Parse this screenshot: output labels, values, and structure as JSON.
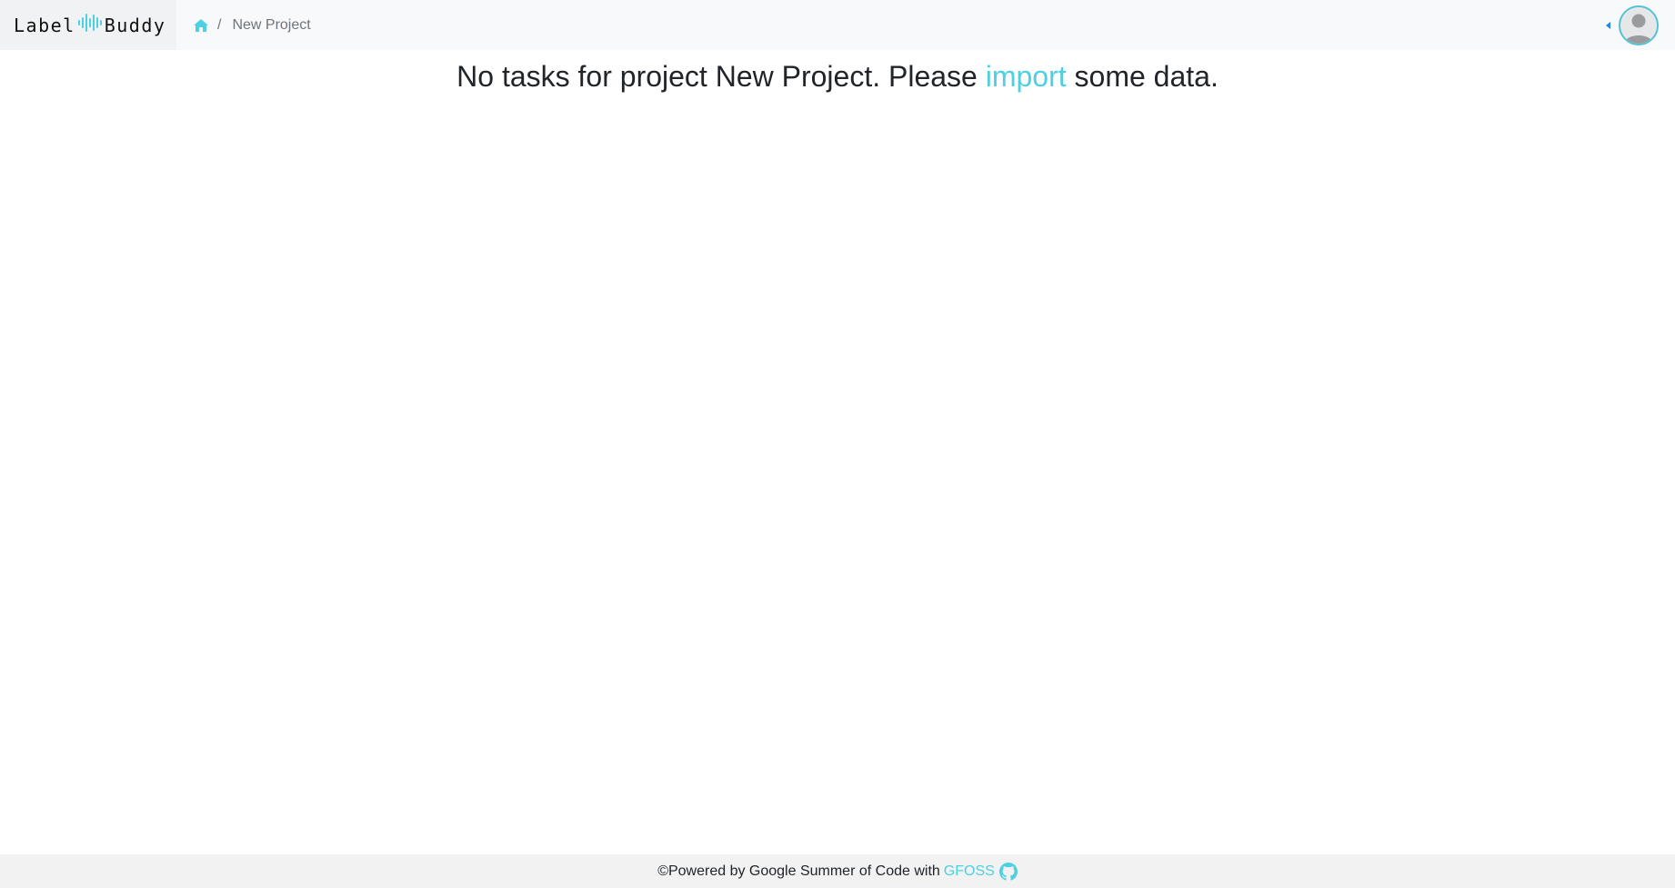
{
  "header": {
    "brand_left": "Label",
    "brand_right": "Buddy",
    "breadcrumb_separator": "/",
    "breadcrumb_current": "New Project",
    "home_icon": "home-icon",
    "avatar_icon": "user-avatar-icon"
  },
  "main": {
    "message_prefix": "No tasks for project New Project. Please ",
    "import_link": "import",
    "message_suffix": " some data."
  },
  "footer": {
    "text": "©Powered by Google Summer of Code with ",
    "link": "GFOSS",
    "github_icon": "github-icon"
  },
  "colors": {
    "accent": "#4dd0e1",
    "navbar_bg": "#f8f9fa",
    "footer_bg": "#f2f2f2"
  }
}
